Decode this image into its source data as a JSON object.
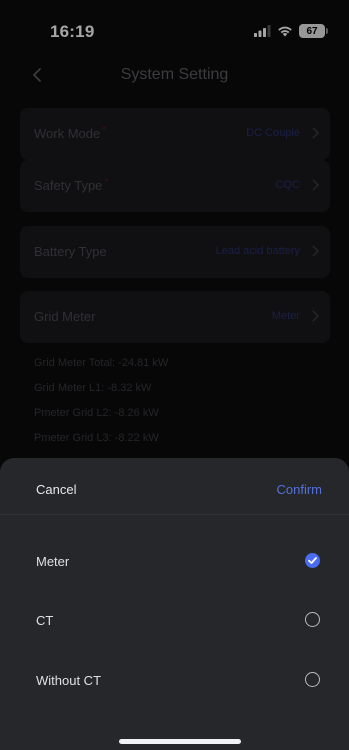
{
  "status_bar": {
    "time": "16:19",
    "battery": "67"
  },
  "nav": {
    "title": "System Setting",
    "back_icon": "chevron-left-icon"
  },
  "settings": {
    "work_mode": {
      "label": "Work Mode",
      "value": "DC Couple"
    },
    "safety_type": {
      "label": "Safety Type",
      "value": "CQC"
    },
    "battery_type": {
      "label": "Battery Type",
      "value": "Lead acid battery"
    },
    "grid_meter": {
      "label": "Grid Meter",
      "value": "Meter"
    },
    "required_mark": "*"
  },
  "readings": [
    "Grid Meter Total: -24.81 kW",
    "Grid Meter L1: -8.32 kW",
    "Pmeter Grid L2: -8.26 kW",
    "Pmeter Grid L3: -8.22 kW"
  ],
  "sheet": {
    "cancel": "Cancel",
    "confirm": "Confirm",
    "options": [
      {
        "label": "Meter",
        "selected": true
      },
      {
        "label": "CT",
        "selected": false
      },
      {
        "label": "Without CT",
        "selected": false
      }
    ]
  },
  "colors": {
    "accent": "#4a6cf0",
    "sheet_bg": "#25272b",
    "confirm": "#5571d8"
  }
}
